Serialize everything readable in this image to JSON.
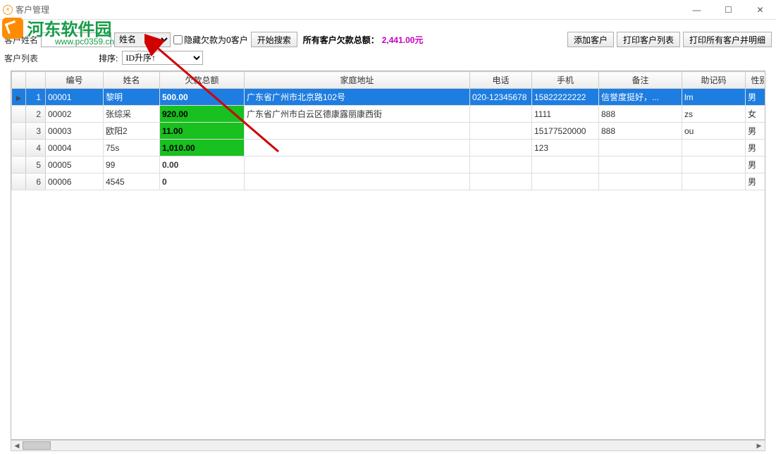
{
  "window": {
    "title": "客户管理"
  },
  "watermark": {
    "text": "河东软件园",
    "url": "www.pc0359.cn"
  },
  "toolbar": {
    "name_label": "客户姓名",
    "name_value": "",
    "search_field_options": [
      "姓名"
    ],
    "search_field_value": "姓名",
    "hide_zero_label": "隐藏欠款为0客户",
    "search_btn": "开始搜索",
    "total_label": "所有客户欠款总额：",
    "total_value": "2,441.00元",
    "add_btn": "添加客户",
    "print_list_btn": "打印客户列表",
    "print_all_btn": "打印所有客户并明细"
  },
  "subbar": {
    "list_label": "客户列表",
    "sort_label": "排序:",
    "sort_value": "ID升序↑"
  },
  "grid": {
    "headers": {
      "id": "编号",
      "name": "姓名",
      "amount": "欠款总额",
      "address": "家庭地址",
      "phone": "电话",
      "mobile": "手机",
      "remark": "备注",
      "code": "助记码",
      "gender": "性别"
    },
    "rows": [
      {
        "num": "1",
        "id": "00001",
        "name": "黎明",
        "amount": "500.00",
        "amount_style": "selected",
        "address": "广东省广州市北京路102号",
        "phone": "020-12345678",
        "mobile": "15822222222",
        "remark": "信誉度挺好，...",
        "code": "lm",
        "gender": "男",
        "selected": true
      },
      {
        "num": "2",
        "id": "00002",
        "name": "张综采",
        "amount": "920.00",
        "amount_style": "green",
        "address": "广东省广州市白云区德康露丽康西街",
        "phone": "",
        "mobile": "1111",
        "remark": "888",
        "code": "zs",
        "gender": "女"
      },
      {
        "num": "3",
        "id": "00003",
        "name": "欧阳2",
        "amount": "11.00",
        "amount_style": "green",
        "address": "",
        "phone": "",
        "mobile": "15177520000",
        "remark": "888",
        "code": "ou",
        "gender": "男"
      },
      {
        "num": "4",
        "id": "00004",
        "name": "75s",
        "amount": "1,010.00",
        "amount_style": "green",
        "address": "",
        "phone": "",
        "mobile": "123",
        "remark": "",
        "code": "",
        "gender": "男"
      },
      {
        "num": "5",
        "id": "00005",
        "name": "99",
        "amount": "0.00",
        "amount_style": "plain",
        "address": "",
        "phone": "",
        "mobile": "",
        "remark": "",
        "code": "",
        "gender": "男"
      },
      {
        "num": "6",
        "id": "00006",
        "name": "4545",
        "amount": "0",
        "amount_style": "plain",
        "address": "",
        "phone": "",
        "mobile": "",
        "remark": "",
        "code": "",
        "gender": "男"
      }
    ]
  }
}
